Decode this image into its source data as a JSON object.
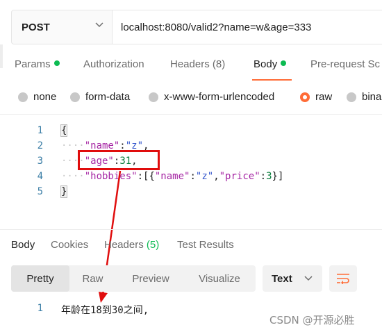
{
  "request": {
    "method": "POST",
    "url": "localhost:8080/valid2?name=w&age=333"
  },
  "request_tabs": [
    {
      "label": "Params",
      "dot": true
    },
    {
      "label": "Authorization"
    },
    {
      "label": "Headers (8)"
    },
    {
      "label": "Body",
      "dot": true,
      "active": true
    },
    {
      "label": "Pre-request Sc"
    }
  ],
  "body_types": [
    {
      "label": "none"
    },
    {
      "label": "form-data"
    },
    {
      "label": "x-www-form-urlencoded"
    },
    {
      "label": "raw",
      "selected": true
    },
    {
      "label": "bina"
    }
  ],
  "editor": {
    "line_numbers": [
      "1",
      "2",
      "3",
      "4",
      "5"
    ],
    "lines": [
      {
        "open_brace": "{"
      },
      {
        "key": "\"name\"",
        "colon": ":",
        "value": "\"z\"",
        "comma": ","
      },
      {
        "key": "\"age\"",
        "colon": ":",
        "value": "31",
        "comma": ","
      },
      {
        "key": "\"hobbies\"",
        "colon": ":",
        "rest_open": "[{",
        "k1": "\"name\"",
        "c1": ":",
        "v1": "\"z\"",
        "sep": ",",
        "k2": "\"price\"",
        "c2": ":",
        "v2": "3",
        "rest_close": "}]"
      },
      {
        "close_brace": "}"
      }
    ]
  },
  "response_tabs": [
    {
      "label": "Body",
      "active": true
    },
    {
      "label": "Cookies"
    },
    {
      "label": "Headers",
      "count": "(5)"
    },
    {
      "label": "Test Results"
    }
  ],
  "response_formats": [
    {
      "label": "Pretty",
      "active": true
    },
    {
      "label": "Raw"
    },
    {
      "label": "Preview"
    },
    {
      "label": "Visualize"
    }
  ],
  "response_type": "Text",
  "response": {
    "line_number": "1",
    "text": "年龄在18到30之间,"
  },
  "watermark": "CSDN @开源必胜",
  "colors": {
    "accent": "#ff6c37",
    "status_dot": "#0cbb52",
    "annotation_red": "#e00d0d"
  }
}
